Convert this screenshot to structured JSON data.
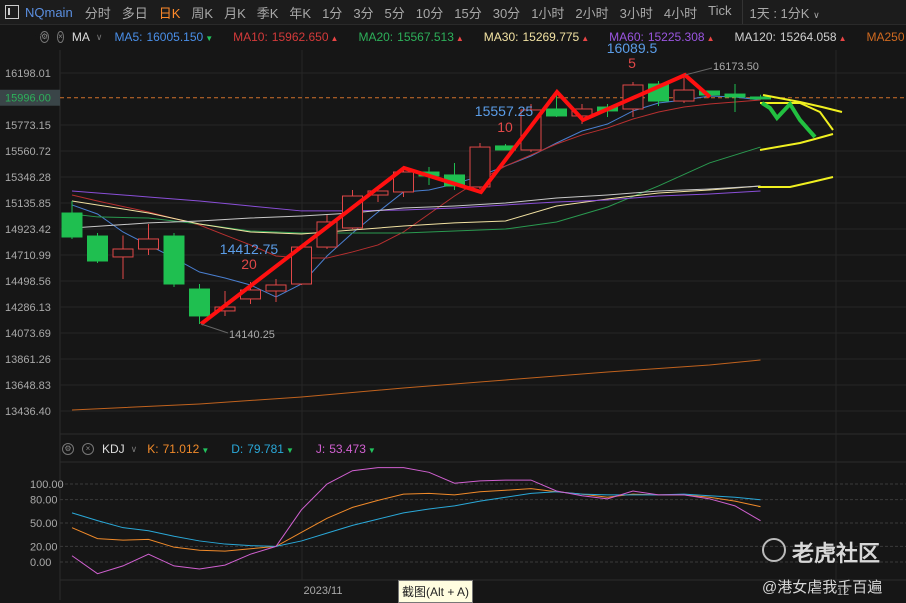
{
  "topbar": {
    "symbol": "NQmain",
    "periods": [
      "分时",
      "多日",
      "日K",
      "周K",
      "月K",
      "季K",
      "年K",
      "1分",
      "3分",
      "5分",
      "10分",
      "15分",
      "30分",
      "1小时",
      "2小时",
      "3小时",
      "4小时",
      "Tick"
    ],
    "active_period": "日K",
    "range_select": "1天 : 1分K"
  },
  "ma_bar": {
    "indicator": "MA",
    "items": [
      {
        "label": "MA5:",
        "value": "16005.150",
        "dir": "down",
        "color": "#4a8fe8"
      },
      {
        "label": "MA10:",
        "value": "15962.650",
        "dir": "up",
        "color": "#d33a3a"
      },
      {
        "label": "MA20:",
        "value": "15567.513",
        "dir": "up",
        "color": "#2db05a"
      },
      {
        "label": "MA30:",
        "value": "15269.775",
        "dir": "up",
        "color": "#f2e2a2"
      },
      {
        "label": "MA60:",
        "value": "15225.308",
        "dir": "up",
        "color": "#9a55e0"
      },
      {
        "label": "MA120:",
        "value": "15264.058",
        "dir": "up",
        "color": "#d0d0d0"
      },
      {
        "label": "MA250",
        "value": "",
        "dir": "",
        "color": "#d06a20"
      }
    ]
  },
  "kdj_bar": {
    "indicator": "KDJ",
    "items": [
      {
        "label": "K:",
        "value": "71.012",
        "dir": "down",
        "color": "#f08a2a"
      },
      {
        "label": "D:",
        "value": "79.781",
        "dir": "down",
        "color": "#2aa8d8"
      },
      {
        "label": "J:",
        "value": "53.473",
        "dir": "down",
        "color": "#d060d0"
      }
    ]
  },
  "chart_data": [
    {
      "type": "candlestick",
      "title": "NQmain 日K",
      "yticks": [
        "16198.01",
        "15773.15",
        "15560.72",
        "15348.28",
        "15135.85",
        "14923.42",
        "14710.99",
        "14498.56",
        "14286.13",
        "14073.69",
        "13861.26",
        "13648.83",
        "13436.40"
      ],
      "current_price": "15996.00",
      "ylim": [
        13436.4,
        16198.01
      ],
      "candles": [
        [
          15054,
          14858,
          15152,
          14842
        ],
        [
          14866,
          14662,
          14891,
          14646
        ],
        [
          14695,
          14760,
          14870,
          14515
        ],
        [
          14760,
          14842,
          14964,
          14711
        ],
        [
          14866,
          14474,
          14891,
          14450
        ],
        [
          14433,
          14213,
          14474,
          14147
        ],
        [
          14254,
          14286,
          14417,
          14213
        ],
        [
          14352,
          14425,
          14490,
          14311
        ],
        [
          14417,
          14466,
          14515,
          14327
        ],
        [
          14474,
          14776,
          14776,
          14466
        ],
        [
          14776,
          14981,
          15038,
          14760
        ],
        [
          14932,
          15193,
          15242,
          14923
        ],
        [
          15201,
          15234,
          15234,
          15144
        ],
        [
          15226,
          15389,
          15422,
          15185
        ],
        [
          15389,
          15357,
          15430,
          15283
        ],
        [
          15365,
          15275,
          15463,
          15242
        ],
        [
          15267,
          15593,
          15626,
          15250
        ],
        [
          15602,
          15569,
          15618,
          15569
        ],
        [
          15569,
          15896,
          15945,
          15553
        ],
        [
          15904,
          15847,
          16059,
          15839
        ],
        [
          15847,
          15904,
          15945,
          15781
        ],
        [
          15920,
          15888,
          15945,
          15839
        ],
        [
          15904,
          16100,
          16124,
          15839
        ],
        [
          16108,
          15969,
          16133,
          15928
        ],
        [
          15969,
          16059,
          16182,
          15953
        ],
        [
          16051,
          16018,
          16043,
          16002
        ],
        [
          16026,
          16002,
          16108,
          15879
        ],
        [
          16002,
          15986,
          16020,
          15980
        ]
      ],
      "ma": {
        "MA5": [
          [
            0,
            15120
          ],
          [
            1,
            15046
          ],
          [
            2,
            14899
          ],
          [
            3,
            14793
          ],
          [
            4,
            14686
          ],
          [
            5,
            14572
          ],
          [
            6,
            14523
          ],
          [
            7,
            14466
          ],
          [
            8,
            14368
          ],
          [
            9,
            14474
          ],
          [
            10,
            14703
          ],
          [
            11,
            14891
          ],
          [
            12,
            15062
          ],
          [
            13,
            15226
          ],
          [
            14,
            15242
          ],
          [
            15,
            15291
          ],
          [
            16,
            15357
          ],
          [
            17,
            15438
          ],
          [
            18,
            15520
          ],
          [
            19,
            15626
          ],
          [
            20,
            15724
          ],
          [
            21,
            15781
          ],
          [
            22,
            15888
          ],
          [
            23,
            15953
          ],
          [
            24,
            15977
          ],
          [
            25,
            16010
          ],
          [
            26,
            16002
          ],
          [
            27,
            15977
          ]
        ],
        "MA10": [
          [
            0,
            15201
          ],
          [
            1,
            15152
          ],
          [
            3,
            15062
          ],
          [
            5,
            14956
          ],
          [
            6,
            14874
          ],
          [
            7,
            14793
          ],
          [
            8,
            14703
          ],
          [
            9,
            14686
          ],
          [
            10,
            14686
          ],
          [
            11,
            14736
          ],
          [
            12,
            14793
          ],
          [
            13,
            14899
          ],
          [
            14,
            15046
          ],
          [
            15,
            15193
          ],
          [
            16,
            15324
          ],
          [
            17,
            15438
          ],
          [
            18,
            15528
          ],
          [
            19,
            15618
          ],
          [
            20,
            15692
          ],
          [
            21,
            15749
          ],
          [
            22,
            15822
          ],
          [
            23,
            15879
          ],
          [
            24,
            15920
          ],
          [
            25,
            15945
          ],
          [
            27,
            15977
          ]
        ],
        "MA20": [
          [
            0,
            15046
          ],
          [
            1,
            15022
          ],
          [
            3,
            15013
          ],
          [
            5,
            14964
          ],
          [
            7,
            14907
          ],
          [
            9,
            14891
          ],
          [
            11,
            14891
          ],
          [
            13,
            14891
          ],
          [
            15,
            14907
          ],
          [
            17,
            14923
          ],
          [
            19,
            14981
          ],
          [
            21,
            15103
          ],
          [
            23,
            15275
          ],
          [
            25,
            15463
          ],
          [
            27,
            15593
          ]
        ],
        "MA30": [
          [
            0,
            15152
          ],
          [
            3,
            15054
          ],
          [
            5,
            14964
          ],
          [
            7,
            14899
          ],
          [
            9,
            14883
          ],
          [
            11,
            14915
          ],
          [
            13,
            14948
          ],
          [
            15,
            14973
          ],
          [
            17,
            14989
          ],
          [
            19,
            15111
          ],
          [
            21,
            15169
          ],
          [
            23,
            15218
          ],
          [
            25,
            15242
          ],
          [
            27,
            15275
          ]
        ],
        "MA60": [
          [
            0,
            15234
          ],
          [
            3,
            15185
          ],
          [
            5,
            15152
          ],
          [
            7,
            15111
          ],
          [
            9,
            15071
          ],
          [
            11,
            15071
          ],
          [
            13,
            15079
          ],
          [
            15,
            15095
          ],
          [
            17,
            15120
          ],
          [
            19,
            15144
          ],
          [
            21,
            15160
          ],
          [
            23,
            15193
          ],
          [
            25,
            15209
          ],
          [
            27,
            15234
          ]
        ],
        "MA120": [
          [
            0,
            14932
          ],
          [
            3,
            14973
          ],
          [
            5,
            14989
          ],
          [
            7,
            15013
          ],
          [
            9,
            15030
          ],
          [
            11,
            15054
          ],
          [
            13,
            15095
          ],
          [
            15,
            15111
          ],
          [
            17,
            15136
          ],
          [
            19,
            15177
          ],
          [
            21,
            15201
          ],
          [
            23,
            15234
          ],
          [
            25,
            15250
          ],
          [
            27,
            15275
          ]
        ],
        "MA250": [
          [
            0,
            13445
          ],
          [
            5,
            13494
          ],
          [
            9,
            13551
          ],
          [
            13,
            13624
          ],
          [
            17,
            13690
          ],
          [
            21,
            13755
          ],
          [
            25,
            13812
          ],
          [
            27,
            13853
          ]
        ]
      },
      "annotations": [
        {
          "price": "14412.75",
          "count": "20"
        },
        {
          "price": "15557.25",
          "count": "10"
        },
        {
          "price": "16089.5",
          "count": "5"
        },
        {
          "label": "16173.50"
        },
        {
          "label": "14140.25"
        }
      ],
      "xticks": [
        "2023/11",
        "12"
      ]
    },
    {
      "type": "line",
      "title": "KDJ",
      "yticks": [
        "100.00",
        "80.00",
        "50.00",
        "20.00",
        "0.00"
      ],
      "ylim": [
        -20,
        130
      ],
      "series": [
        {
          "name": "K",
          "color": "#f08a2a",
          "values": [
            44,
            30,
            28,
            29,
            19,
            15,
            14,
            17,
            20,
            38,
            56,
            70,
            79,
            87,
            88,
            86,
            90,
            92,
            94,
            90,
            87,
            83,
            87,
            86,
            86,
            83,
            78,
            71
          ]
        },
        {
          "name": "D",
          "color": "#2aa8d8",
          "values": [
            63,
            53,
            44,
            40,
            33,
            27,
            23,
            21,
            20,
            27,
            37,
            47,
            55,
            63,
            68,
            72,
            78,
            83,
            88,
            90,
            87,
            86,
            86,
            86,
            87,
            85,
            83,
            79.8
          ]
        },
        {
          "name": "J",
          "color": "#d060d0",
          "values": [
            8,
            -15,
            -5,
            10,
            -5,
            -9,
            -4,
            10,
            20,
            67,
            100,
            117,
            121,
            121,
            115,
            101,
            104,
            105,
            105,
            91,
            85,
            81,
            91,
            86,
            86,
            81,
            72,
            53
          ]
        }
      ]
    }
  ],
  "tooltip": "截图(Alt + A)",
  "watermark": {
    "title": "老虎社区",
    "user": "@港女虐我千百遍"
  }
}
